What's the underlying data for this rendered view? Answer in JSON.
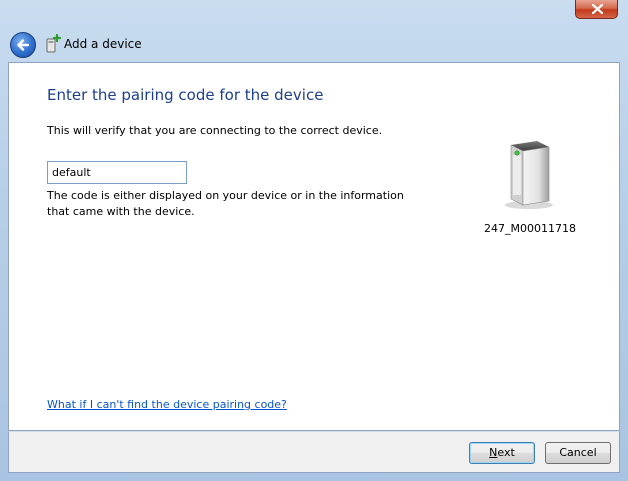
{
  "window": {
    "title": "Add a device"
  },
  "page": {
    "heading": "Enter the pairing code for the device",
    "instruction": "This will verify that you are connecting to the correct device.",
    "code_input": {
      "value": "default",
      "placeholder": ""
    },
    "code_hint": "The code is either displayed on your device or in the information that came with the device.",
    "device_name": "247_M00011718",
    "help_link": "What if I can't find the device pairing code?"
  },
  "buttons": {
    "next_first": "N",
    "next_rest": "ext",
    "cancel": "Cancel"
  },
  "icons": {
    "back": "back-arrow-icon",
    "close": "close-icon",
    "add_device": "add-device-icon",
    "device": "printer-device-icon"
  }
}
